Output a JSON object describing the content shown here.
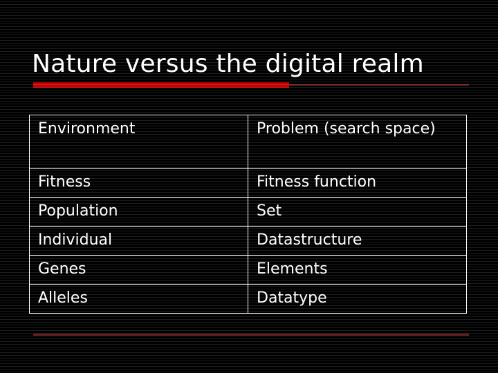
{
  "slide": {
    "title": "Nature versus the digital realm",
    "background_color": "#000000",
    "text_color": "#ffffff",
    "accent_color": "#cc0000",
    "accent_muted_color": "#6d2120"
  },
  "table": {
    "headers": [
      "Environment",
      "Problem (search space)"
    ],
    "rows": [
      {
        "nature": "Fitness",
        "digital": "Fitness function"
      },
      {
        "nature": "Population",
        "digital": "Set"
      },
      {
        "nature": "Individual",
        "digital": "Datastructure"
      },
      {
        "nature": "Genes",
        "digital": "Elements"
      },
      {
        "nature": "Alleles",
        "digital": "Datatype"
      }
    ]
  }
}
